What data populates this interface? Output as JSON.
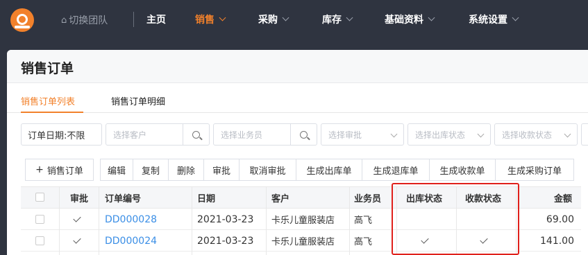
{
  "nav": {
    "team": "切换团队",
    "items": [
      {
        "label": "主页",
        "active": false,
        "has_menu": false
      },
      {
        "label": "销售",
        "active": true,
        "has_menu": true
      },
      {
        "label": "采购",
        "active": false,
        "has_menu": true
      },
      {
        "label": "库存",
        "active": false,
        "has_menu": true
      },
      {
        "label": "基础资料",
        "active": false,
        "has_menu": true
      },
      {
        "label": "系统设置",
        "active": false,
        "has_menu": true
      }
    ]
  },
  "page": {
    "title": "销售订单",
    "tabs": [
      "销售订单列表",
      "销售订单明细"
    ]
  },
  "filters": {
    "date": "订单日期:不限",
    "customer_placeholder": "选择客户",
    "salesperson_placeholder": "选择业务员",
    "audit_placeholder": "选择审批",
    "outbound_placeholder": "选择出库状态",
    "payment_placeholder": "选择收款状态"
  },
  "toolbar": {
    "add": "销售订单",
    "edit": "编辑",
    "copy": "复制",
    "delete": "删除",
    "approve": "审批",
    "cancel_approve": "取消审批",
    "gen_outbound": "生成出库单",
    "gen_return": "生成退库单",
    "gen_receipt": "生成收款单",
    "gen_purchase": "生成采购订单"
  },
  "table": {
    "columns": [
      "审批",
      "订单编号",
      "日期",
      "客户",
      "业务员",
      "出库状态",
      "收款状态",
      "金额"
    ],
    "rows": [
      {
        "approved": true,
        "order_no": "DD000028",
        "date": "2021-03-23",
        "customer": "卡乐儿童服装店",
        "salesperson": "高飞",
        "outbound": false,
        "paid": false,
        "amount": "69.00"
      },
      {
        "approved": true,
        "order_no": "DD000024",
        "date": "2021-03-23",
        "customer": "卡乐儿童服装店",
        "salesperson": "高飞",
        "outbound": true,
        "paid": true,
        "amount": "141.00"
      }
    ]
  },
  "colors": {
    "accent": "#f2812b",
    "link": "#3a8ee6",
    "highlight": "#e0201b",
    "nav_bg": "#2f3440"
  }
}
